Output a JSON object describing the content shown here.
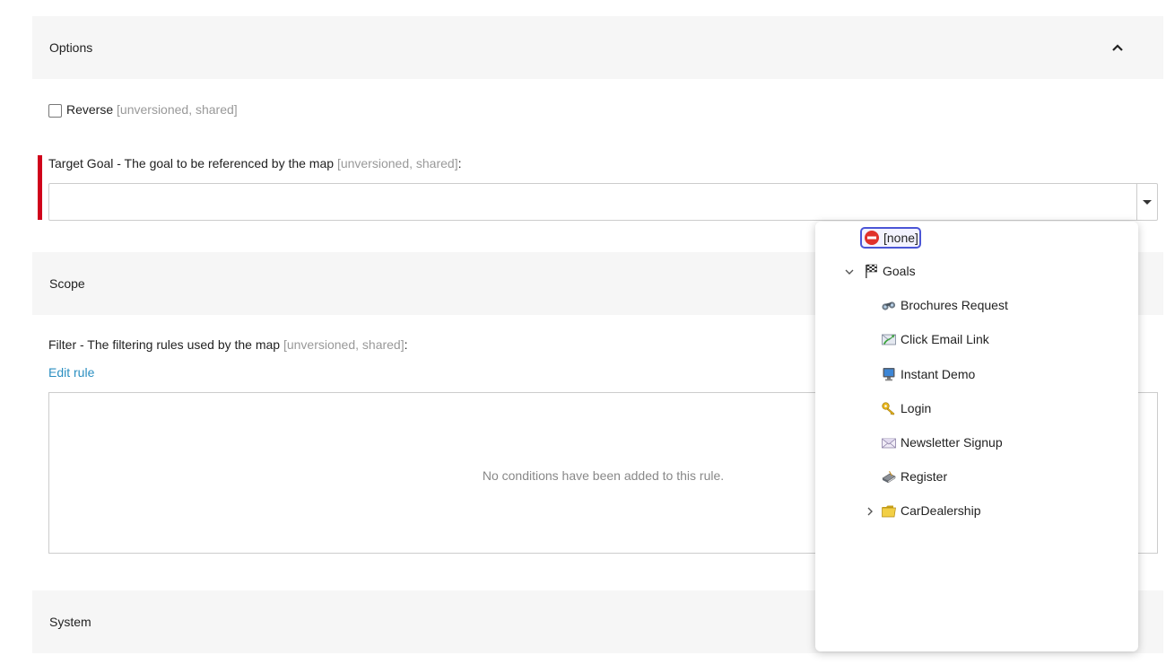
{
  "sections": {
    "options": "Options",
    "scope": "Scope",
    "system": "System"
  },
  "reverse": {
    "label": "Reverse",
    "tag": "[unversioned, shared]",
    "checked": false
  },
  "target_goal": {
    "label": "Target Goal - The goal to be referenced by the map",
    "tag": "[unversioned, shared]",
    "suffix": ":",
    "value": ""
  },
  "filter": {
    "label": "Filter - The filtering rules used by the map",
    "tag": "[unversioned, shared]",
    "suffix": ":",
    "edit_link": "Edit rule",
    "empty_text": "No conditions have been added to this rule."
  },
  "tree": {
    "none": "[none]",
    "root": "Goals",
    "goals": [
      {
        "label": "Brochures Request",
        "icon": "binoculars-icon"
      },
      {
        "label": "Click Email Link",
        "icon": "email-link-icon"
      },
      {
        "label": "Instant Demo",
        "icon": "monitor-icon"
      },
      {
        "label": "Login",
        "icon": "key-icon"
      },
      {
        "label": "Newsletter Signup",
        "icon": "envelope-icon"
      },
      {
        "label": "Register",
        "icon": "register-book-icon"
      }
    ],
    "folder": "CarDealership"
  },
  "colors": {
    "required": "#d0021b",
    "link": "#2b8fc1",
    "selection": "#4b55d6"
  }
}
